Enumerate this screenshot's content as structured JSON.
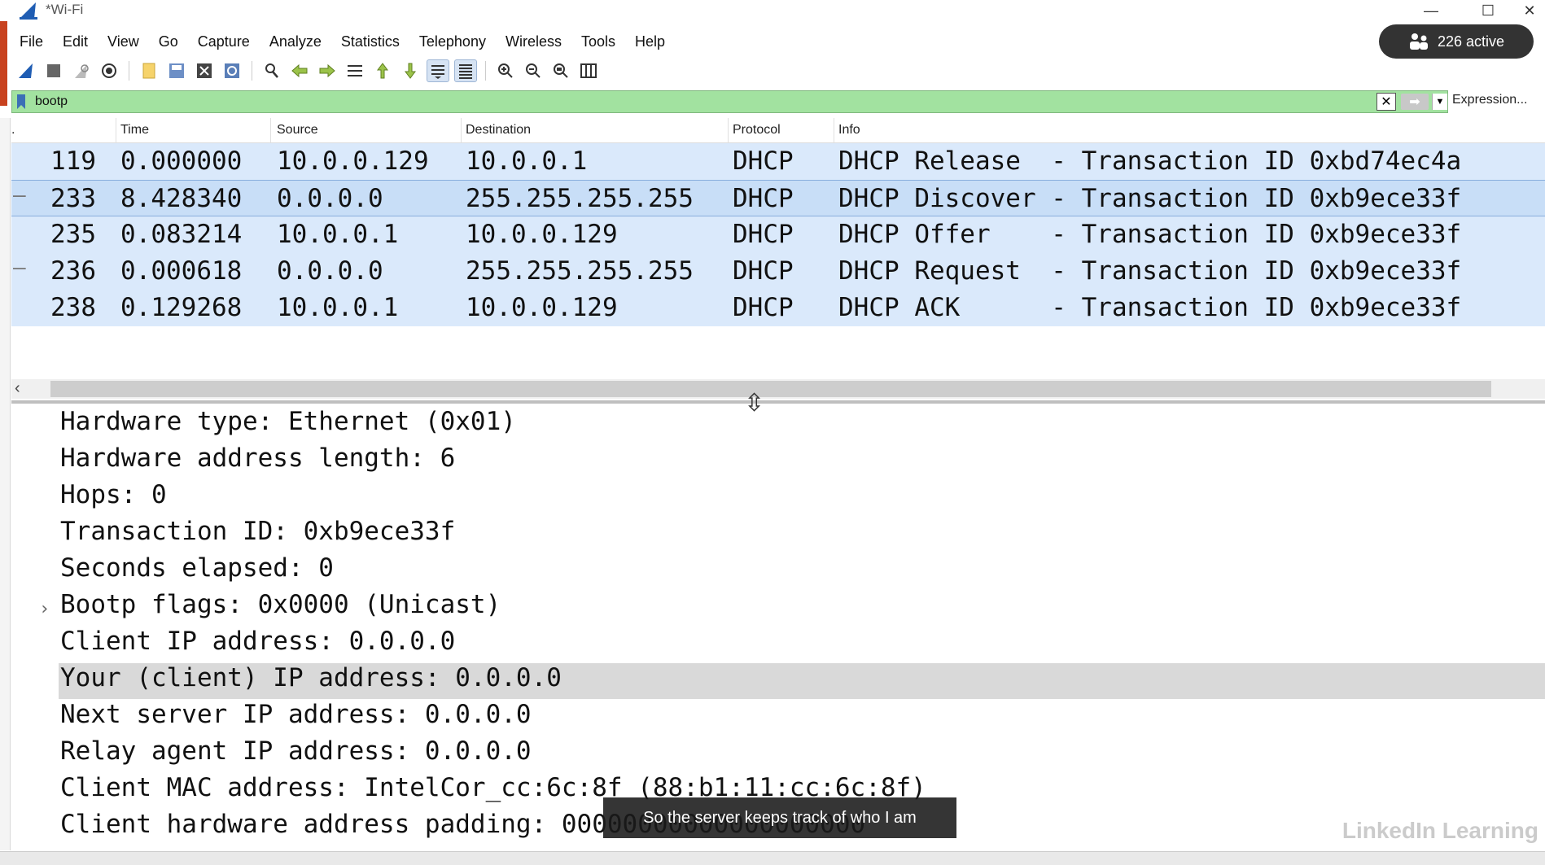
{
  "window": {
    "title": "*Wi-Fi",
    "minimize": "—",
    "maximize": "☐",
    "close": "✕"
  },
  "menu": [
    "File",
    "Edit",
    "View",
    "Go",
    "Capture",
    "Analyze",
    "Statistics",
    "Telephony",
    "Wireless",
    "Tools",
    "Help"
  ],
  "badge": {
    "label": "226 active"
  },
  "toolbar_icons": [
    "shark-fin-start-icon",
    "stop-square-icon",
    "restart-fin-icon",
    "capture-options-icon",
    "open-file-icon",
    "save-file-icon",
    "close-file-icon",
    "reload-icon",
    "find-icon",
    "go-back-icon",
    "go-forward-icon",
    "go-to-packet-icon",
    "first-packet-icon",
    "last-packet-icon",
    "autoscroll-icon",
    "colorize-icon",
    "zoom-in-icon",
    "zoom-out-icon",
    "zoom-normal-icon",
    "resize-columns-icon"
  ],
  "filter": {
    "value": "bootp",
    "expression_label": "Expression..."
  },
  "columns": [
    ".",
    "Time",
    "Source",
    "Destination",
    "Protocol",
    "Info"
  ],
  "packets": [
    {
      "no": "119",
      "time": "0.000000",
      "source": "10.0.0.129",
      "destination": "10.0.0.1",
      "protocol": "DHCP",
      "info": "DHCP Release  - Transaction ID 0xbd74ec4a",
      "mark": ""
    },
    {
      "no": "233",
      "time": "8.428340",
      "source": "0.0.0.0",
      "destination": "255.255.255.255",
      "protocol": "DHCP",
      "info": "DHCP Discover - Transaction ID 0xb9ece33f",
      "mark": "—",
      "selected": true
    },
    {
      "no": "235",
      "time": "0.083214",
      "source": "10.0.0.1",
      "destination": "10.0.0.129",
      "protocol": "DHCP",
      "info": "DHCP Offer    - Transaction ID 0xb9ece33f",
      "mark": ""
    },
    {
      "no": "236",
      "time": "0.000618",
      "source": "0.0.0.0",
      "destination": "255.255.255.255",
      "protocol": "DHCP",
      "info": "DHCP Request  - Transaction ID 0xb9ece33f",
      "mark": "—"
    },
    {
      "no": "238",
      "time": "0.129268",
      "source": "10.0.0.1",
      "destination": "10.0.0.129",
      "protocol": "DHCP",
      "info": "DHCP ACK      - Transaction ID 0xb9ece33f",
      "mark": ""
    }
  ],
  "details": [
    {
      "text": "Hardware type: Ethernet (0x01)"
    },
    {
      "text": "Hardware address length: 6"
    },
    {
      "text": "Hops: 0"
    },
    {
      "text": "Transaction ID: 0xb9ece33f"
    },
    {
      "text": "Seconds elapsed: 0"
    },
    {
      "text": "Bootp flags: 0x0000 (Unicast)",
      "expandable": true
    },
    {
      "text": "Client IP address: 0.0.0.0"
    },
    {
      "text": "Your (client) IP address: 0.0.0.0",
      "highlighted": true
    },
    {
      "text": "Next server IP address: 0.0.0.0"
    },
    {
      "text": "Relay agent IP address: 0.0.0.0"
    },
    {
      "text": "Client MAC address: IntelCor_cc:6c:8f (88:b1:11:cc:6c:8f)"
    },
    {
      "text": "Client hardware address padding: 00000000000000000000"
    }
  ],
  "caption": "So the server keeps track of who I am",
  "watermark": "LinkedIn Learning",
  "colors": {
    "filter_valid": "#a2e2a0",
    "row_bg": "#dae9fb",
    "row_selected": "#c8def7",
    "detail_highlight": "#d9d9d9"
  }
}
